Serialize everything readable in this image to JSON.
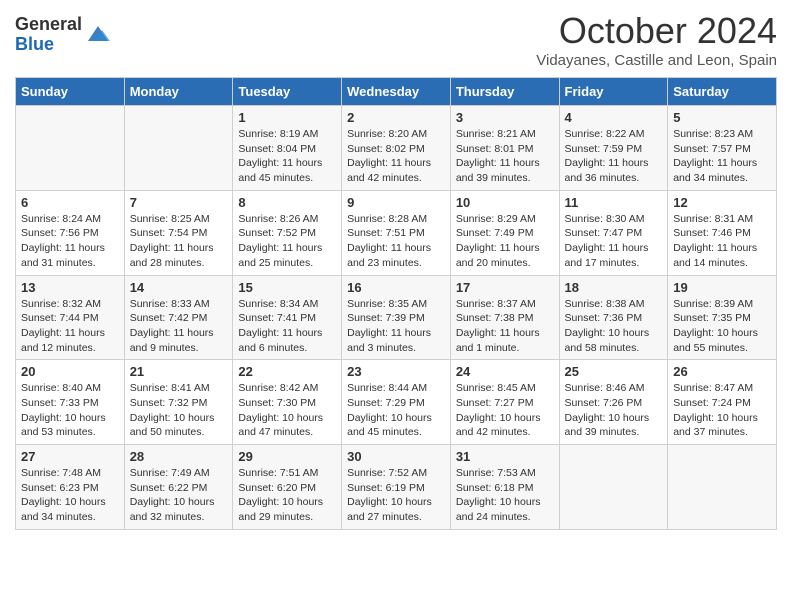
{
  "logo": {
    "general": "General",
    "blue": "Blue"
  },
  "header": {
    "month": "October 2024",
    "location": "Vidayanes, Castille and Leon, Spain"
  },
  "weekdays": [
    "Sunday",
    "Monday",
    "Tuesday",
    "Wednesday",
    "Thursday",
    "Friday",
    "Saturday"
  ],
  "weeks": [
    [
      {
        "day": "",
        "content": ""
      },
      {
        "day": "",
        "content": ""
      },
      {
        "day": "1",
        "content": "Sunrise: 8:19 AM\nSunset: 8:04 PM\nDaylight: 11 hours and 45 minutes."
      },
      {
        "day": "2",
        "content": "Sunrise: 8:20 AM\nSunset: 8:02 PM\nDaylight: 11 hours and 42 minutes."
      },
      {
        "day": "3",
        "content": "Sunrise: 8:21 AM\nSunset: 8:01 PM\nDaylight: 11 hours and 39 minutes."
      },
      {
        "day": "4",
        "content": "Sunrise: 8:22 AM\nSunset: 7:59 PM\nDaylight: 11 hours and 36 minutes."
      },
      {
        "day": "5",
        "content": "Sunrise: 8:23 AM\nSunset: 7:57 PM\nDaylight: 11 hours and 34 minutes."
      }
    ],
    [
      {
        "day": "6",
        "content": "Sunrise: 8:24 AM\nSunset: 7:56 PM\nDaylight: 11 hours and 31 minutes."
      },
      {
        "day": "7",
        "content": "Sunrise: 8:25 AM\nSunset: 7:54 PM\nDaylight: 11 hours and 28 minutes."
      },
      {
        "day": "8",
        "content": "Sunrise: 8:26 AM\nSunset: 7:52 PM\nDaylight: 11 hours and 25 minutes."
      },
      {
        "day": "9",
        "content": "Sunrise: 8:28 AM\nSunset: 7:51 PM\nDaylight: 11 hours and 23 minutes."
      },
      {
        "day": "10",
        "content": "Sunrise: 8:29 AM\nSunset: 7:49 PM\nDaylight: 11 hours and 20 minutes."
      },
      {
        "day": "11",
        "content": "Sunrise: 8:30 AM\nSunset: 7:47 PM\nDaylight: 11 hours and 17 minutes."
      },
      {
        "day": "12",
        "content": "Sunrise: 8:31 AM\nSunset: 7:46 PM\nDaylight: 11 hours and 14 minutes."
      }
    ],
    [
      {
        "day": "13",
        "content": "Sunrise: 8:32 AM\nSunset: 7:44 PM\nDaylight: 11 hours and 12 minutes."
      },
      {
        "day": "14",
        "content": "Sunrise: 8:33 AM\nSunset: 7:42 PM\nDaylight: 11 hours and 9 minutes."
      },
      {
        "day": "15",
        "content": "Sunrise: 8:34 AM\nSunset: 7:41 PM\nDaylight: 11 hours and 6 minutes."
      },
      {
        "day": "16",
        "content": "Sunrise: 8:35 AM\nSunset: 7:39 PM\nDaylight: 11 hours and 3 minutes."
      },
      {
        "day": "17",
        "content": "Sunrise: 8:37 AM\nSunset: 7:38 PM\nDaylight: 11 hours and 1 minute."
      },
      {
        "day": "18",
        "content": "Sunrise: 8:38 AM\nSunset: 7:36 PM\nDaylight: 10 hours and 58 minutes."
      },
      {
        "day": "19",
        "content": "Sunrise: 8:39 AM\nSunset: 7:35 PM\nDaylight: 10 hours and 55 minutes."
      }
    ],
    [
      {
        "day": "20",
        "content": "Sunrise: 8:40 AM\nSunset: 7:33 PM\nDaylight: 10 hours and 53 minutes."
      },
      {
        "day": "21",
        "content": "Sunrise: 8:41 AM\nSunset: 7:32 PM\nDaylight: 10 hours and 50 minutes."
      },
      {
        "day": "22",
        "content": "Sunrise: 8:42 AM\nSunset: 7:30 PM\nDaylight: 10 hours and 47 minutes."
      },
      {
        "day": "23",
        "content": "Sunrise: 8:44 AM\nSunset: 7:29 PM\nDaylight: 10 hours and 45 minutes."
      },
      {
        "day": "24",
        "content": "Sunrise: 8:45 AM\nSunset: 7:27 PM\nDaylight: 10 hours and 42 minutes."
      },
      {
        "day": "25",
        "content": "Sunrise: 8:46 AM\nSunset: 7:26 PM\nDaylight: 10 hours and 39 minutes."
      },
      {
        "day": "26",
        "content": "Sunrise: 8:47 AM\nSunset: 7:24 PM\nDaylight: 10 hours and 37 minutes."
      }
    ],
    [
      {
        "day": "27",
        "content": "Sunrise: 7:48 AM\nSunset: 6:23 PM\nDaylight: 10 hours and 34 minutes."
      },
      {
        "day": "28",
        "content": "Sunrise: 7:49 AM\nSunset: 6:22 PM\nDaylight: 10 hours and 32 minutes."
      },
      {
        "day": "29",
        "content": "Sunrise: 7:51 AM\nSunset: 6:20 PM\nDaylight: 10 hours and 29 minutes."
      },
      {
        "day": "30",
        "content": "Sunrise: 7:52 AM\nSunset: 6:19 PM\nDaylight: 10 hours and 27 minutes."
      },
      {
        "day": "31",
        "content": "Sunrise: 7:53 AM\nSunset: 6:18 PM\nDaylight: 10 hours and 24 minutes."
      },
      {
        "day": "",
        "content": ""
      },
      {
        "day": "",
        "content": ""
      }
    ]
  ]
}
